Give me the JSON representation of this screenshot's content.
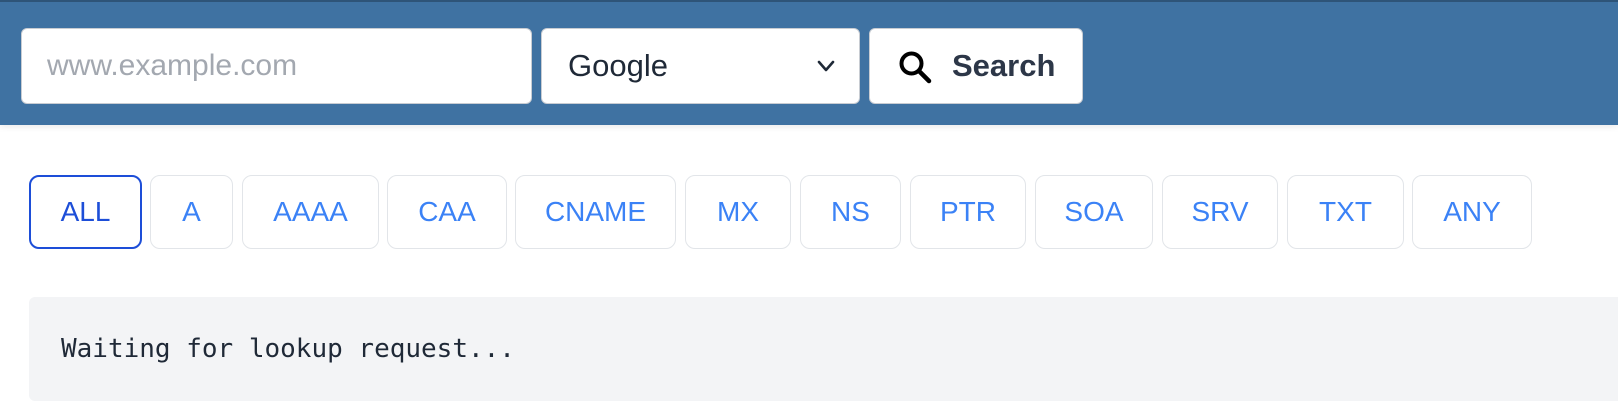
{
  "search": {
    "placeholder": "www.example.com",
    "value": ""
  },
  "resolver": {
    "selected": "Google",
    "icon": "chevron-down-icon"
  },
  "search_button": {
    "label": "Search",
    "icon": "search-icon"
  },
  "record_types": {
    "active": "ALL",
    "items": [
      "ALL",
      "A",
      "AAAA",
      "CAA",
      "CNAME",
      "MX",
      "NS",
      "PTR",
      "SOA",
      "SRV",
      "TXT",
      "ANY"
    ]
  },
  "result": {
    "text": "Waiting for lookup request..."
  },
  "colors": {
    "header_bg": "#3f72a2",
    "tab_text": "#3b82f6",
    "tab_active": "#1d4ed8",
    "result_bg": "#f3f4f6"
  }
}
